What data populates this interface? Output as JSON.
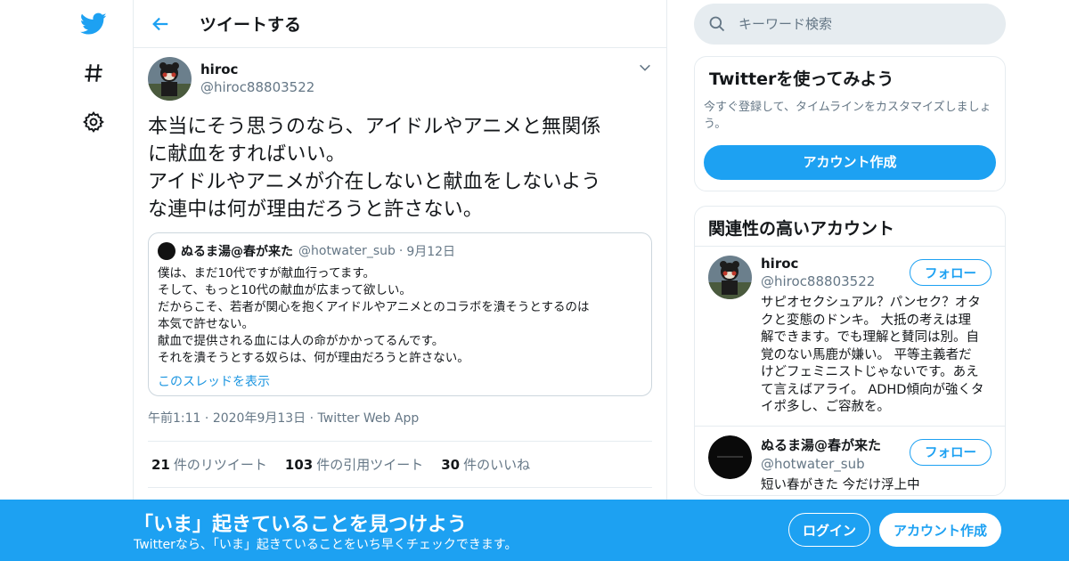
{
  "header": {
    "title": "ツイートする"
  },
  "tweet": {
    "author_name": "hiroc",
    "author_handle": "@hiroc88803522",
    "text": "本当にそう思うのなら、アイドルやアニメと無関係\nに献血をすればいい。\nアイドルやアニメが介在しないと献血をしないよう\nな連中は何が理由だろうと許さない。",
    "quote": {
      "name": "ぬるま湯@春が来た",
      "handle": "@hotwater_sub",
      "date": "9月12日",
      "text": "僕は、まだ10代ですが献血行ってます。\nそして、もっと10代の献血が広まって欲しい。\nだからこそ、若者が関心を抱くアイドルやアニメとのコラボを潰そうとするのは\n本気で許せない。\n献血で提供される血には人の命がかかってるんです。\nそれを潰そうとする奴らは、何が理由だろうと許さない。",
      "thread_link": "このスレッドを表示"
    },
    "time": "午前1:11",
    "date": "2020年9月13日",
    "source": "Twitter Web App",
    "stats": [
      {
        "count": "21",
        "label": "件のリツイート"
      },
      {
        "count": "103",
        "label": "件の引用ツイート"
      },
      {
        "count": "30",
        "label": "件のいいね"
      }
    ]
  },
  "search": {
    "placeholder": "キーワード検索"
  },
  "signup_card": {
    "title": "Twitterを使ってみよう",
    "subtitle": "今すぐ登録して、タイムラインをカスタマイズしましょ\nう。",
    "button": "アカウント作成"
  },
  "related": {
    "title": "関連性の高いアカウント",
    "accounts": [
      {
        "name": "hiroc",
        "handle": "@hiroc88803522",
        "bio": "サピオセクシュアル？パンセク？オタ\nクと変態のドンキ。 大抵の考えは理\n解できます。でも理解と賛同は別。自\n覚のない馬鹿が嫌い。 平等主義者だ\nけどフェミニストじゃないです。あえ\nて言えばアライ。 ADHD傾向が強くタ\nイポ多し、ご容赦を。",
        "follow": "フォロー"
      },
      {
        "name": "ぬるま湯@春が来た",
        "handle": "@hotwater_sub",
        "bio": "短い春がきた 今だけ浮上中",
        "follow": "フォロー"
      }
    ]
  },
  "banner": {
    "title": "「いま」起きていることを見つけよう",
    "subtitle": "Twitterなら、「いま」起きていることをいち早くチェックできます。",
    "login": "ログイン",
    "signup": "アカウント作成"
  },
  "colors": {
    "accent": "#1da1f2",
    "border": "#e6ecf0",
    "muted": "#657786"
  },
  "icons": [
    "twitter-bird-icon",
    "hashtag-icon",
    "gear-icon",
    "back-arrow-icon",
    "chevron-down-icon",
    "search-icon"
  ]
}
